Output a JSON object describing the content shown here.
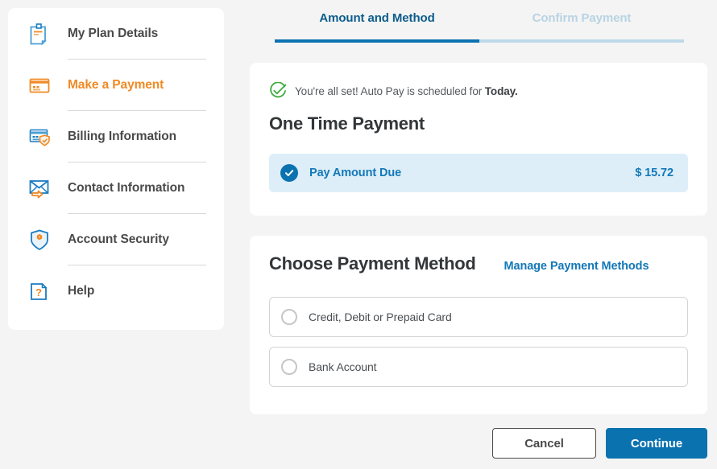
{
  "sidebar": {
    "items": [
      {
        "label": "My Plan Details",
        "icon": "document-note-icon",
        "active": false
      },
      {
        "label": "Make a Payment",
        "icon": "credit-card-icon",
        "active": true
      },
      {
        "label": "Billing Information",
        "icon": "card-shield-icon",
        "active": false
      },
      {
        "label": "Contact Information",
        "icon": "envelope-arrow-icon",
        "active": false
      },
      {
        "label": "Account Security",
        "icon": "shield-gear-icon",
        "active": false
      },
      {
        "label": "Help",
        "icon": "question-file-icon",
        "active": false
      }
    ]
  },
  "tabs": [
    {
      "label": "Amount and Method",
      "state": "active"
    },
    {
      "label": "Confirm Payment",
      "state": "inactive"
    }
  ],
  "payment_card": {
    "status_icon": "check-circle-icon",
    "status_text_prefix": "You're all set! Auto Pay is scheduled for ",
    "status_text_bold": "Today.",
    "title": "One Time Payment",
    "option": {
      "label": "Pay Amount Due",
      "value": "$ 15.72",
      "selected": true,
      "icon": "radio-checked-icon"
    }
  },
  "method_card": {
    "title": "Choose Payment Method",
    "manage_link": "Manage Payment Methods",
    "options": [
      {
        "label": "Credit, Debit or Prepaid Card",
        "selected": false,
        "icon": "radio-empty-icon"
      },
      {
        "label": "Bank Account",
        "selected": false,
        "icon": "radio-empty-icon"
      }
    ]
  },
  "footer": {
    "cancel_label": "Cancel",
    "continue_label": "Continue"
  },
  "colors": {
    "page_background": "#f4f4f4",
    "card_background": "#ffffff",
    "accent_blue": "#0b72b0",
    "link_blue": "#1378b8",
    "active_orange": "#f08a24",
    "tab_inactive": "#b8d3e3",
    "selected_row_bg": "#ddeef8",
    "success_green": "#3bab3b",
    "text_dark": "#4a4a4a"
  }
}
